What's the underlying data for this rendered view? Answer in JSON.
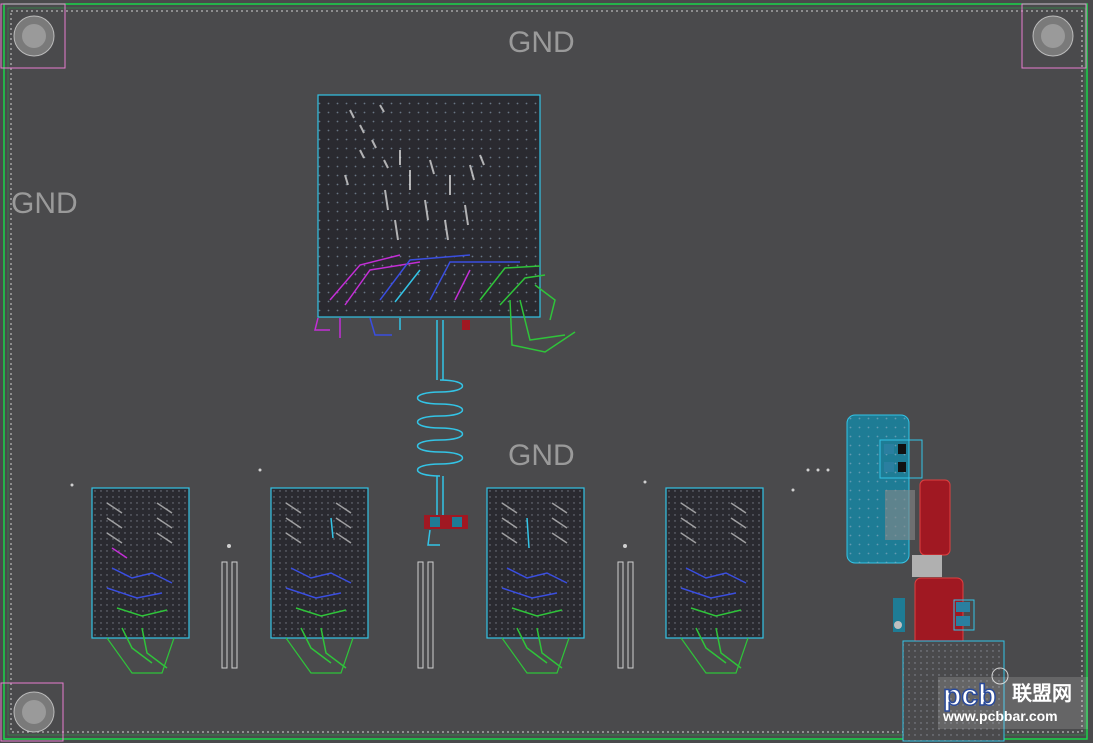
{
  "board": {
    "net_labels": [
      "GND",
      "GND",
      "GND"
    ],
    "colors": {
      "background": "#4a4a4c",
      "outline": "#19d64a",
      "keepout": "#d0d0d0",
      "component_outline": "#33c4e6",
      "trace_green": "#2fc43a",
      "trace_blue": "#3a4ee0",
      "trace_magenta": "#c32ed6",
      "copper_red": "#a01822",
      "copper_teal": "#1e7c95",
      "hole_outline": "#e87cd0"
    }
  },
  "components": {
    "mounting_holes": [
      "mounting-hole",
      "mounting-hole",
      "mounting-hole",
      "mounting-hole"
    ],
    "bga_main": "processor-bga",
    "ddr_chips": [
      "ddr-chip",
      "ddr-chip",
      "ddr-chip",
      "ddr-chip"
    ],
    "power_section": "power-regulator-area"
  },
  "watermark": {
    "brand": "pcb",
    "cn": "联盟网",
    "url": "www.pcbbar.com"
  }
}
